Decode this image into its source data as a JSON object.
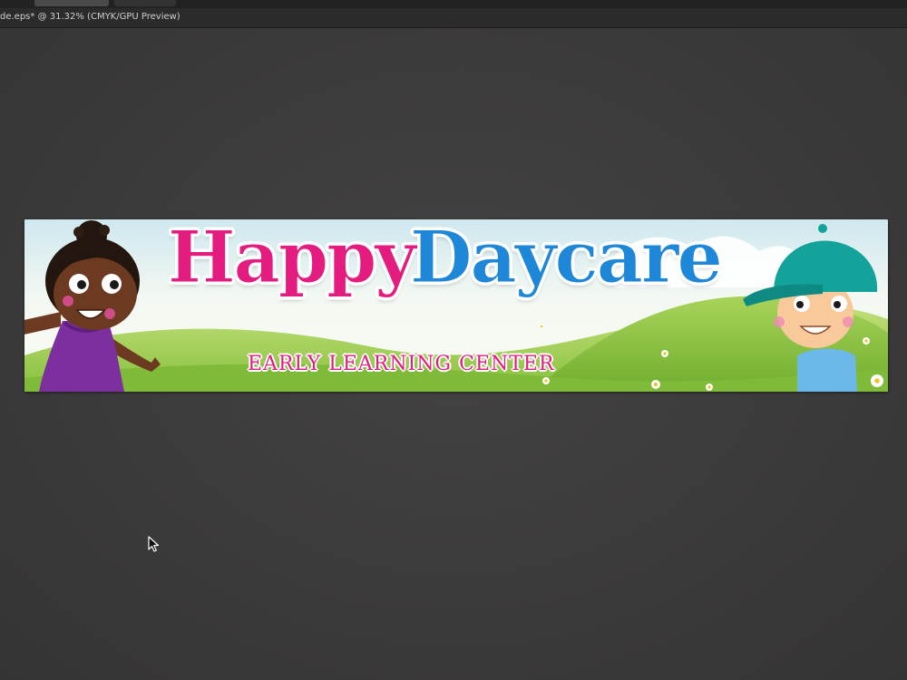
{
  "window": {
    "document_title": "de.eps* @ 31.32% (CMYK/GPU Preview)"
  },
  "artboard": {
    "headline": {
      "word1": "Happy",
      "word2": "Daycare",
      "word1_color": "#e41c7f",
      "word2_color": "#1f87d8"
    },
    "tagline": "EARLY LEARNING CENTER",
    "illustrations": [
      "girl-character-illustration",
      "boy-character-illustration",
      "meadow-background",
      "daisy-flowers"
    ]
  },
  "cursor": "arrow-cursor-icon"
}
